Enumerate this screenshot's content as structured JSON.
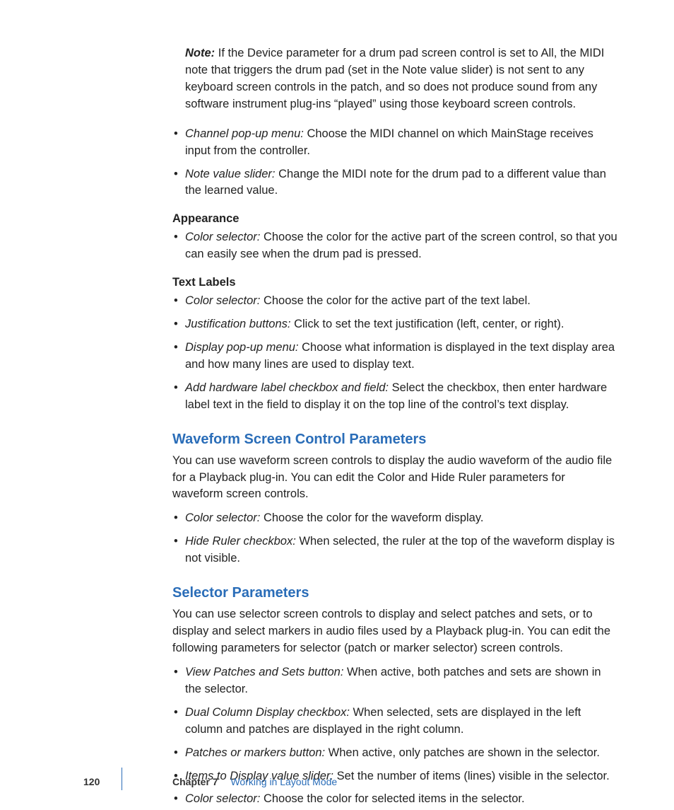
{
  "note": {
    "label": "Note:",
    "text": "  If the Device parameter for a drum pad screen control is set to All, the MIDI note that triggers the drum pad (set in the Note value slider) is not sent to any keyboard screen controls in the patch, and so does not produce sound from any software instrument plug-ins “played” using those keyboard screen controls."
  },
  "topBullets": [
    {
      "term": "Channel pop-up menu:",
      "desc": "  Choose the MIDI channel on which MainStage receives input from the controller."
    },
    {
      "term": "Note value slider:",
      "desc": "  Change the MIDI note for the drum pad to a different value than the learned value."
    }
  ],
  "appearance": {
    "heading": "Appearance",
    "bullets": [
      {
        "term": "Color selector:",
        "desc": "  Choose the color for the active part of the screen control, so that you can easily see when the drum pad is pressed."
      }
    ]
  },
  "textLabels": {
    "heading": "Text Labels",
    "bullets": [
      {
        "term": "Color selector:",
        "desc": "  Choose the color for the active part of the text label."
      },
      {
        "term": "Justification buttons:",
        "desc": "  Click to set the text justification (left, center, or right)."
      },
      {
        "term": "Display pop-up menu:",
        "desc": "  Choose what information is displayed in the text display area and how many lines are used to display text."
      },
      {
        "term": "Add hardware label checkbox and field:",
        "desc": "  Select the checkbox, then enter hardware label text in the field to display it on the top line of the control’s text display."
      }
    ]
  },
  "waveform": {
    "heading": "Waveform Screen Control Parameters",
    "intro": "You can use waveform screen controls to display the audio waveform of the audio file for a Playback plug-in. You can edit the Color and Hide Ruler parameters for waveform screen controls.",
    "bullets": [
      {
        "term": "Color selector:",
        "desc": "  Choose the color for the waveform display."
      },
      {
        "term": "Hide Ruler checkbox:",
        "desc": "  When selected, the ruler at the top of the waveform display is not visible."
      }
    ]
  },
  "selector": {
    "heading": "Selector Parameters",
    "intro": "You can use selector screen controls to display and select patches and sets, or to display and select markers in audio files used by a Playback plug-in. You can edit the following parameters for selector (patch or marker selector) screen controls.",
    "bullets": [
      {
        "term": "View Patches and Sets button:",
        "desc": "  When active, both patches and sets are shown in the selector."
      },
      {
        "term": "Dual Column Display checkbox:",
        "desc": "  When selected, sets are displayed in the left column and patches are displayed in the right column."
      },
      {
        "term": "Patches or markers button:",
        "desc": "  When active, only patches are shown in the selector."
      },
      {
        "term": "Items to Display value slider:",
        "desc": "  Set the number of items (lines) visible in the selector."
      },
      {
        "term": "Color selector:",
        "desc": "  Choose the color for selected items in the selector."
      }
    ]
  },
  "footer": {
    "pageNumber": "120",
    "chapterLabel": "Chapter 7",
    "chapterTitle": "Working in Layout Mode"
  }
}
